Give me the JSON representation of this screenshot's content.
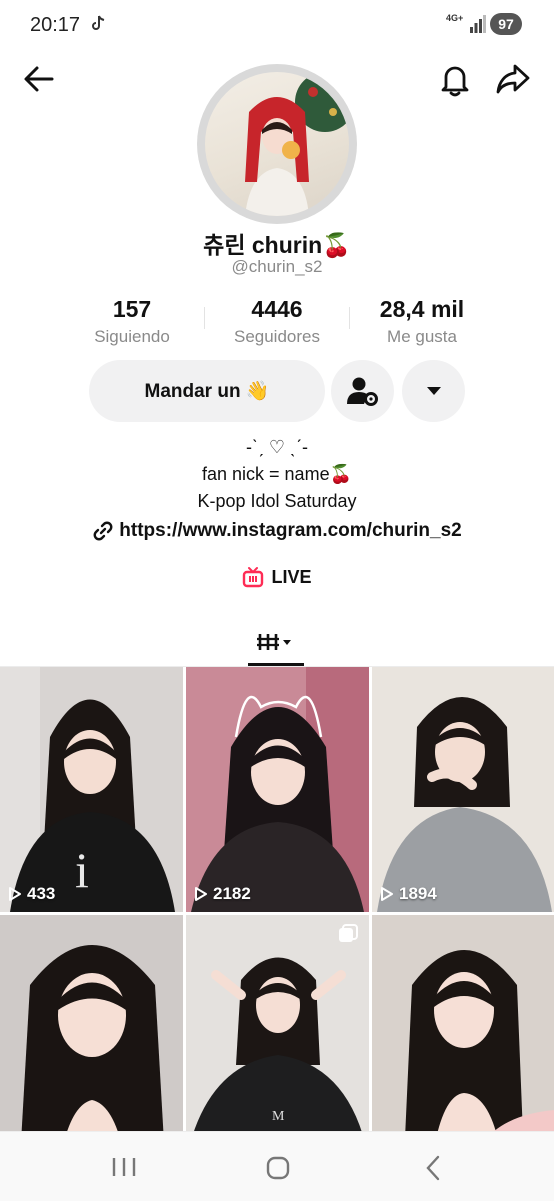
{
  "status": {
    "time": "20:17",
    "network": "4G+",
    "battery": "97"
  },
  "profile": {
    "display_name": "츄린 churin🍒",
    "handle": "@churin_s2",
    "stats": [
      {
        "value": "157",
        "label": "Siguiendo"
      },
      {
        "value": "4446",
        "label": "Seguidores"
      },
      {
        "value": "28,4 mil",
        "label": "Me gusta"
      }
    ],
    "message_button": "Mandar un 👋",
    "bio_lines": [
      "-ˋˏ ♡ ˎˊ-",
      "fan nick = name🍒",
      "K-pop Idol Saturday"
    ],
    "link": "https://www.instagram.com/churin_s2",
    "live_label": "LIVE"
  },
  "videos": [
    {
      "views": "433"
    },
    {
      "views": "2182"
    },
    {
      "views": "1894"
    },
    {
      "views": ""
    },
    {
      "views": ""
    },
    {
      "views": ""
    }
  ],
  "icons": {
    "back": "arrow-left-icon",
    "bell": "bell-icon",
    "share": "share-arrow-icon",
    "add_friend": "person-settings-icon",
    "dropdown": "caret-down-icon",
    "link": "link-icon",
    "live": "tv-icon",
    "grid": "grid-icon",
    "nav_recents": "recents-icon",
    "nav_home": "home-icon",
    "nav_back": "back-icon"
  },
  "colors": {
    "accent_live": "#fe2c55",
    "muted_text": "#8a8a8a",
    "button_bg": "#f1f1f2"
  }
}
